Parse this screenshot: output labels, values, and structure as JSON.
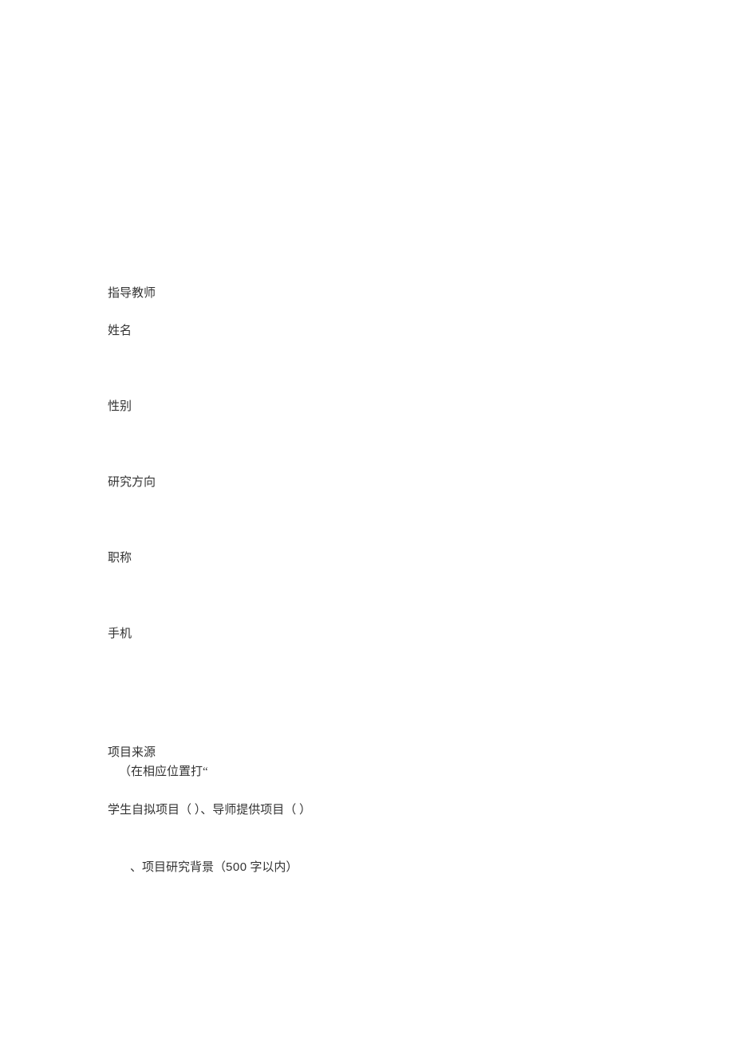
{
  "advisor_section_label": "指导教师",
  "fields": {
    "name": "姓名",
    "gender": "性别",
    "research_direction": "研究方向",
    "title": "职称",
    "phone": "手机"
  },
  "project_source": {
    "label": "项目来源",
    "note_prefix": "（在相应位置打",
    "note_quote": "“",
    "options_text_1": "学生自拟项目（ ）、导师提供项目（ ）"
  },
  "background_section": {
    "bullet": "、",
    "label_prefix": "项目研究背景（",
    "word_limit": "500",
    "label_suffix": "字以内）"
  }
}
